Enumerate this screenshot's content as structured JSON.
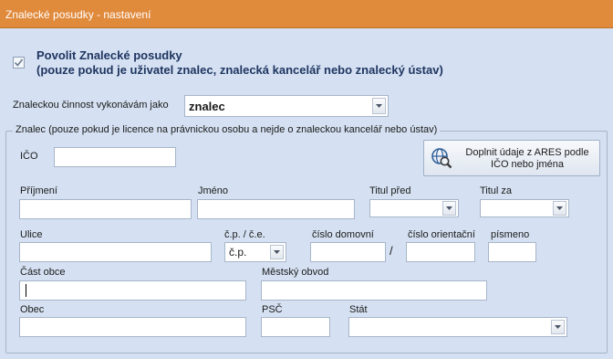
{
  "window": {
    "title": "Znalecké posudky - nastavení"
  },
  "enable": {
    "checked": true,
    "line1": "Povolit Znalecké posudky",
    "line2": "(pouze pokud je uživatel znalec, znalecká kancelář nebo znalecký ústav)"
  },
  "activity": {
    "label": "Znaleckou činnost vykonávám jako",
    "value": "znalec"
  },
  "group": {
    "legend": "Znalec (pouze pokud je licence na právnickou osobu a nejde o znaleckou kancelář nebo ústav)",
    "ico_label": "IČO",
    "ico_value": "",
    "ares_button": {
      "line1": "Doplnit údaje z ARES podle",
      "line2": "IČO nebo jména"
    },
    "prijmeni_label": "Příjmení",
    "jmeno_label": "Jméno",
    "titul_pred_label": "Titul před",
    "titul_za_label": "Titul za",
    "ulice_label": "Ulice",
    "cp_ce_label": "č.p. / č.e.",
    "cp_ce_value": "č.p.",
    "cislo_domovni_label": "číslo domovní",
    "separator": "/",
    "cislo_orientacni_label": "číslo orientační",
    "pismeno_label": "písmeno",
    "cast_obce_label": "Část obce",
    "mestsky_obvod_label": "Městský obvod",
    "obec_label": "Obec",
    "psc_label": "PSČ",
    "stat_label": "Stát"
  },
  "icons": {
    "checkbox": "check-icon",
    "dropdown": "chevron-down-icon",
    "ares": "globe-search-icon"
  },
  "colors": {
    "titlebar": "#e08a3c",
    "background": "#d5e1f2",
    "heading": "#1f3561"
  }
}
